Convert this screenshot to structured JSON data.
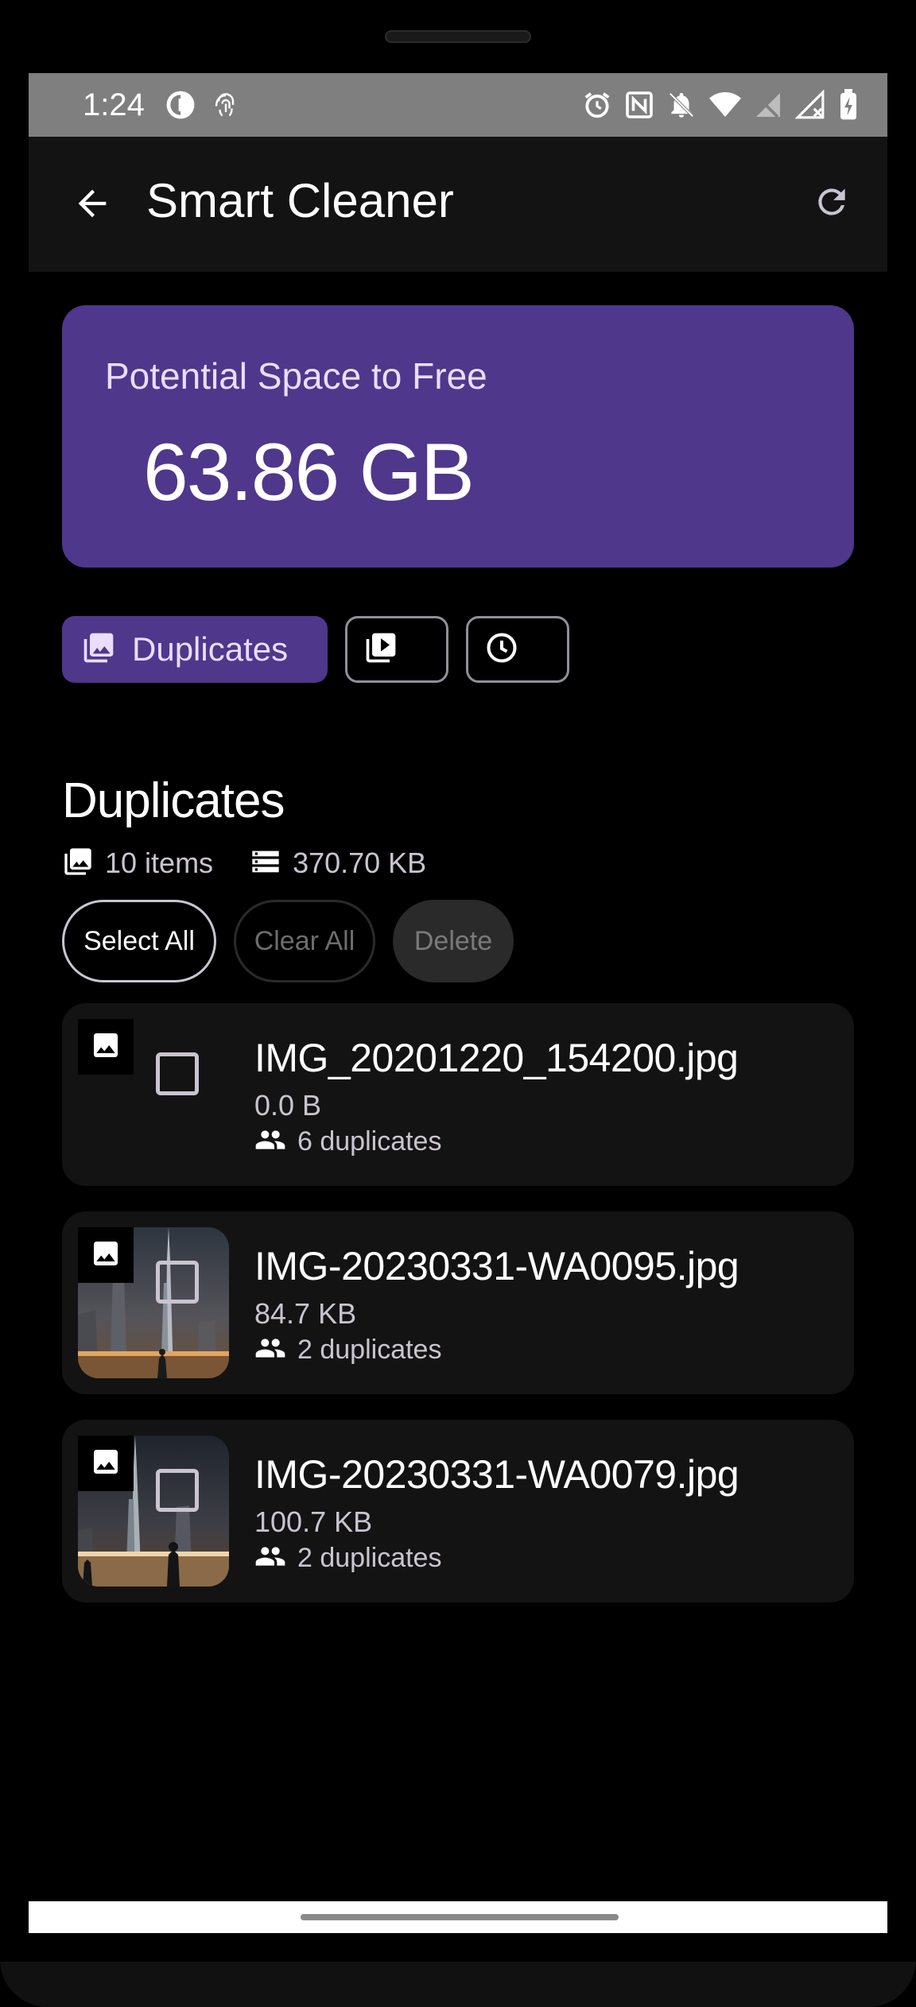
{
  "status_bar": {
    "time": "1:24",
    "left_icons": [
      "data-saver-icon",
      "fingerprint-icon"
    ],
    "right_icons": [
      "alarm-icon",
      "nfc-icon",
      "notifications-off-icon",
      "wifi-icon",
      "no-signal-icon",
      "signal-off-icon",
      "battery-charging-icon"
    ]
  },
  "app_bar": {
    "title": "Smart Cleaner",
    "back_icon": "arrow-back-icon",
    "refresh_icon": "refresh-icon"
  },
  "summary": {
    "label": "Potential Space to Free",
    "value": "63.86 GB",
    "color": "#4f378b"
  },
  "filter_chips": [
    {
      "label": "Duplicates",
      "icon": "photo-library-icon",
      "selected": true
    },
    {
      "label": "",
      "icon": "video-library-icon",
      "selected": false
    },
    {
      "label": "",
      "icon": "clock-icon",
      "selected": false
    }
  ],
  "section": {
    "title": "Duplicates",
    "items_count": "10 items",
    "total_size": "370.70 KB"
  },
  "actions": {
    "select_all": "Select All",
    "clear_all": "Clear All",
    "delete": "Delete"
  },
  "files": [
    {
      "name": "IMG_20201220_154200.jpg",
      "size": "0.0 B",
      "duplicates": "6 duplicates",
      "has_thumbnail": false,
      "checked": false
    },
    {
      "name": "IMG-20230331-WA0095.jpg",
      "size": "84.7 KB",
      "duplicates": "2 duplicates",
      "has_thumbnail": true,
      "checked": false
    },
    {
      "name": "IMG-20230331-WA0079.jpg",
      "size": "100.7 KB",
      "duplicates": "2 duplicates",
      "has_thumbnail": true,
      "checked": false
    }
  ]
}
